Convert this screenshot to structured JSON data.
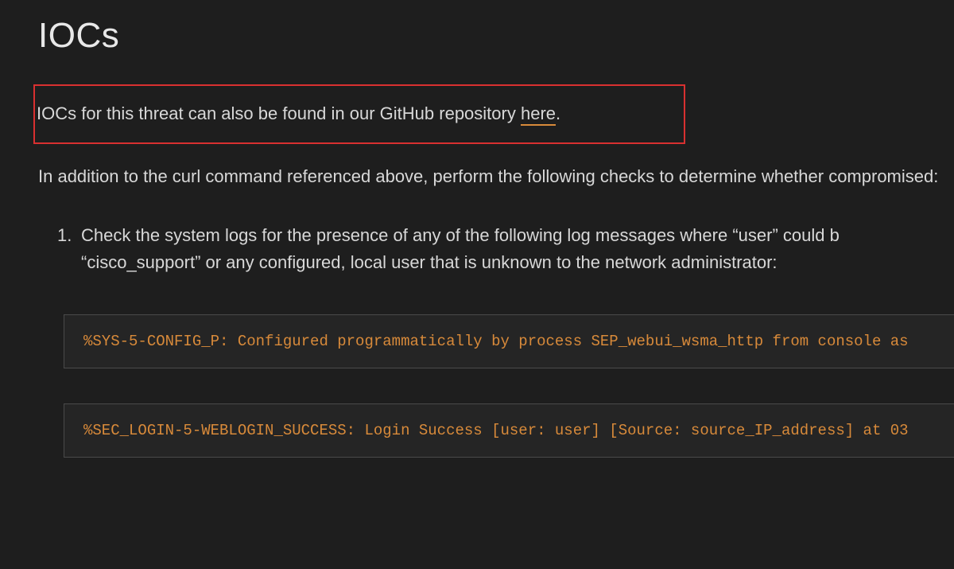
{
  "heading": "IOCs",
  "intro": {
    "prefix": "IOCs for this threat can also be found in our GitHub repository ",
    "link_text": "here",
    "suffix": "."
  },
  "body_para": "In addition to the curl command referenced above, perform the following checks to determine whether compromised:",
  "list": {
    "item1": {
      "marker": "1.",
      "text": "Check the system logs for the presence of any of the following log messages where “user” could b “cisco_support” or any configured, local user that is unknown to the network administrator:"
    }
  },
  "code_blocks": {
    "block1": "%SYS-5-CONFIG_P: Configured programmatically by process SEP_webui_wsma_http from console as",
    "block2": "%SEC_LOGIN-5-WEBLOGIN_SUCCESS: Login Success [user: user] [Source: source_IP_address] at 03"
  }
}
